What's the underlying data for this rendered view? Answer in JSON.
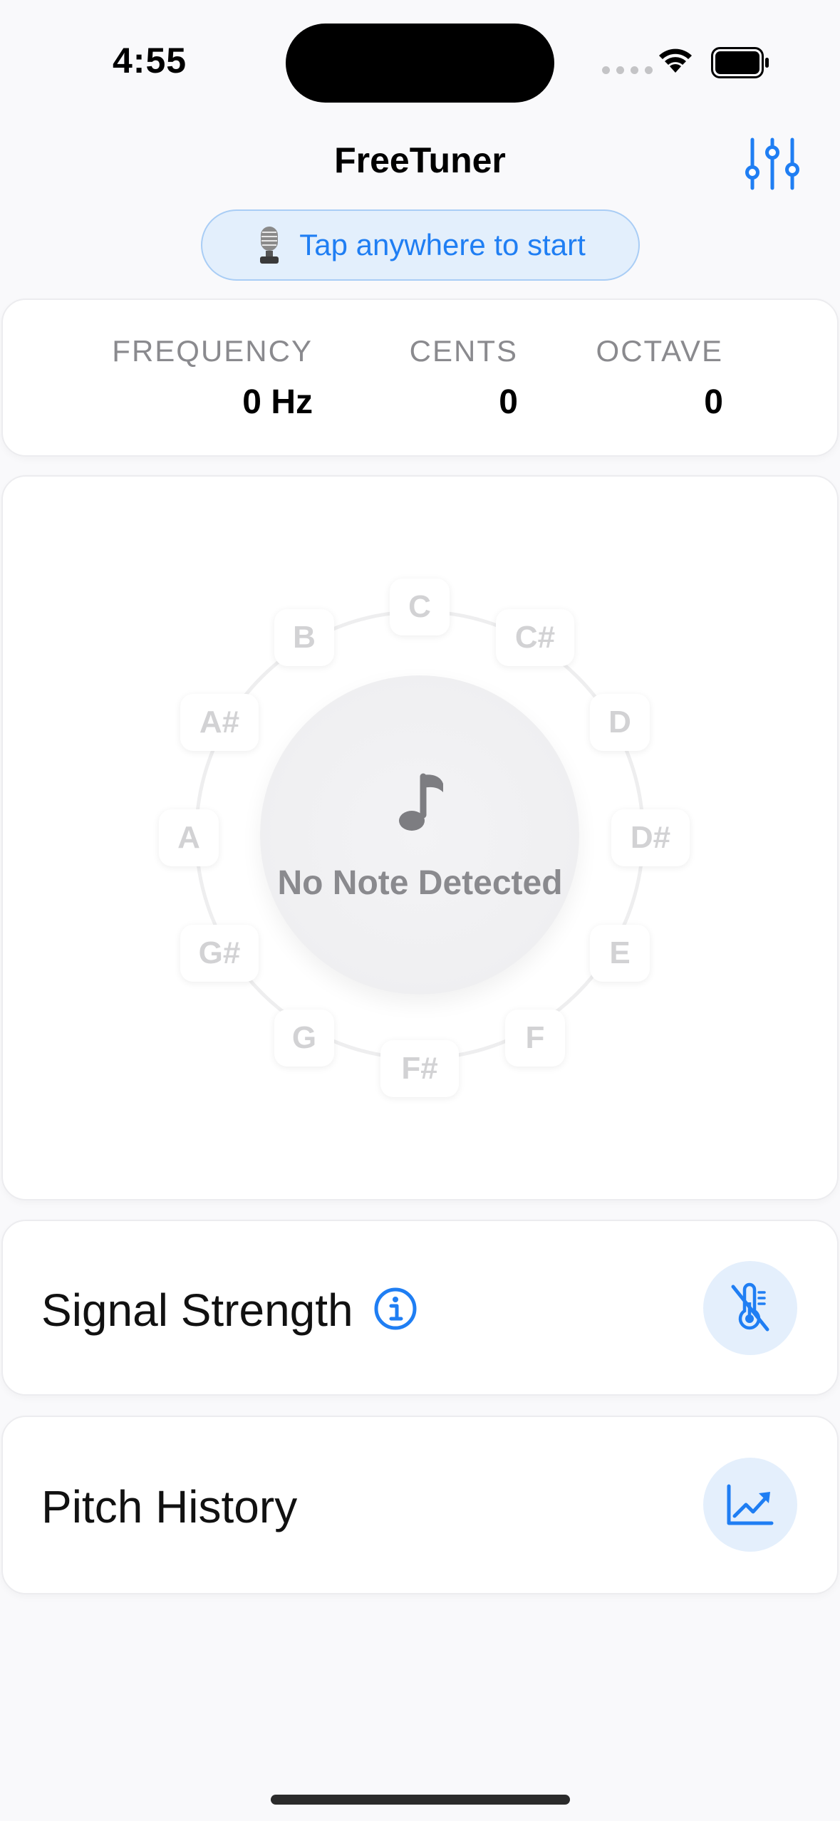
{
  "status_bar": {
    "time": "4:55",
    "icons": [
      "cellular-signal-icon",
      "wifi-icon",
      "battery-icon"
    ]
  },
  "header": {
    "title": "FreeTuner",
    "settings_icon": "sliders-icon",
    "start_prompt": "Tap anywhere to start",
    "start_icon": "microphone-icon"
  },
  "readouts": [
    {
      "label": "FREQUENCY",
      "value": "0 Hz"
    },
    {
      "label": "CENTS",
      "value": "0"
    },
    {
      "label": "OCTAVE",
      "value": "0"
    }
  ],
  "tuner_wheel": {
    "notes": [
      "C",
      "C#",
      "D",
      "D#",
      "E",
      "F",
      "F#",
      "G",
      "G#",
      "A",
      "A#",
      "B"
    ],
    "center_icon": "music-note-icon",
    "status": "No Note Detected"
  },
  "signal_strength": {
    "title": "Signal Strength",
    "info_icon": "info-icon",
    "action_icon": "thermometer-slash-icon"
  },
  "pitch_history": {
    "title": "Pitch History",
    "action_icon": "chart-trend-icon"
  },
  "colors": {
    "accent": "#1f7ef3",
    "pill_bg": "#e3effc",
    "muted_text": "#8a8a8e",
    "note_chip_text": "#d2d2d4",
    "background": "#f9f9fb"
  }
}
